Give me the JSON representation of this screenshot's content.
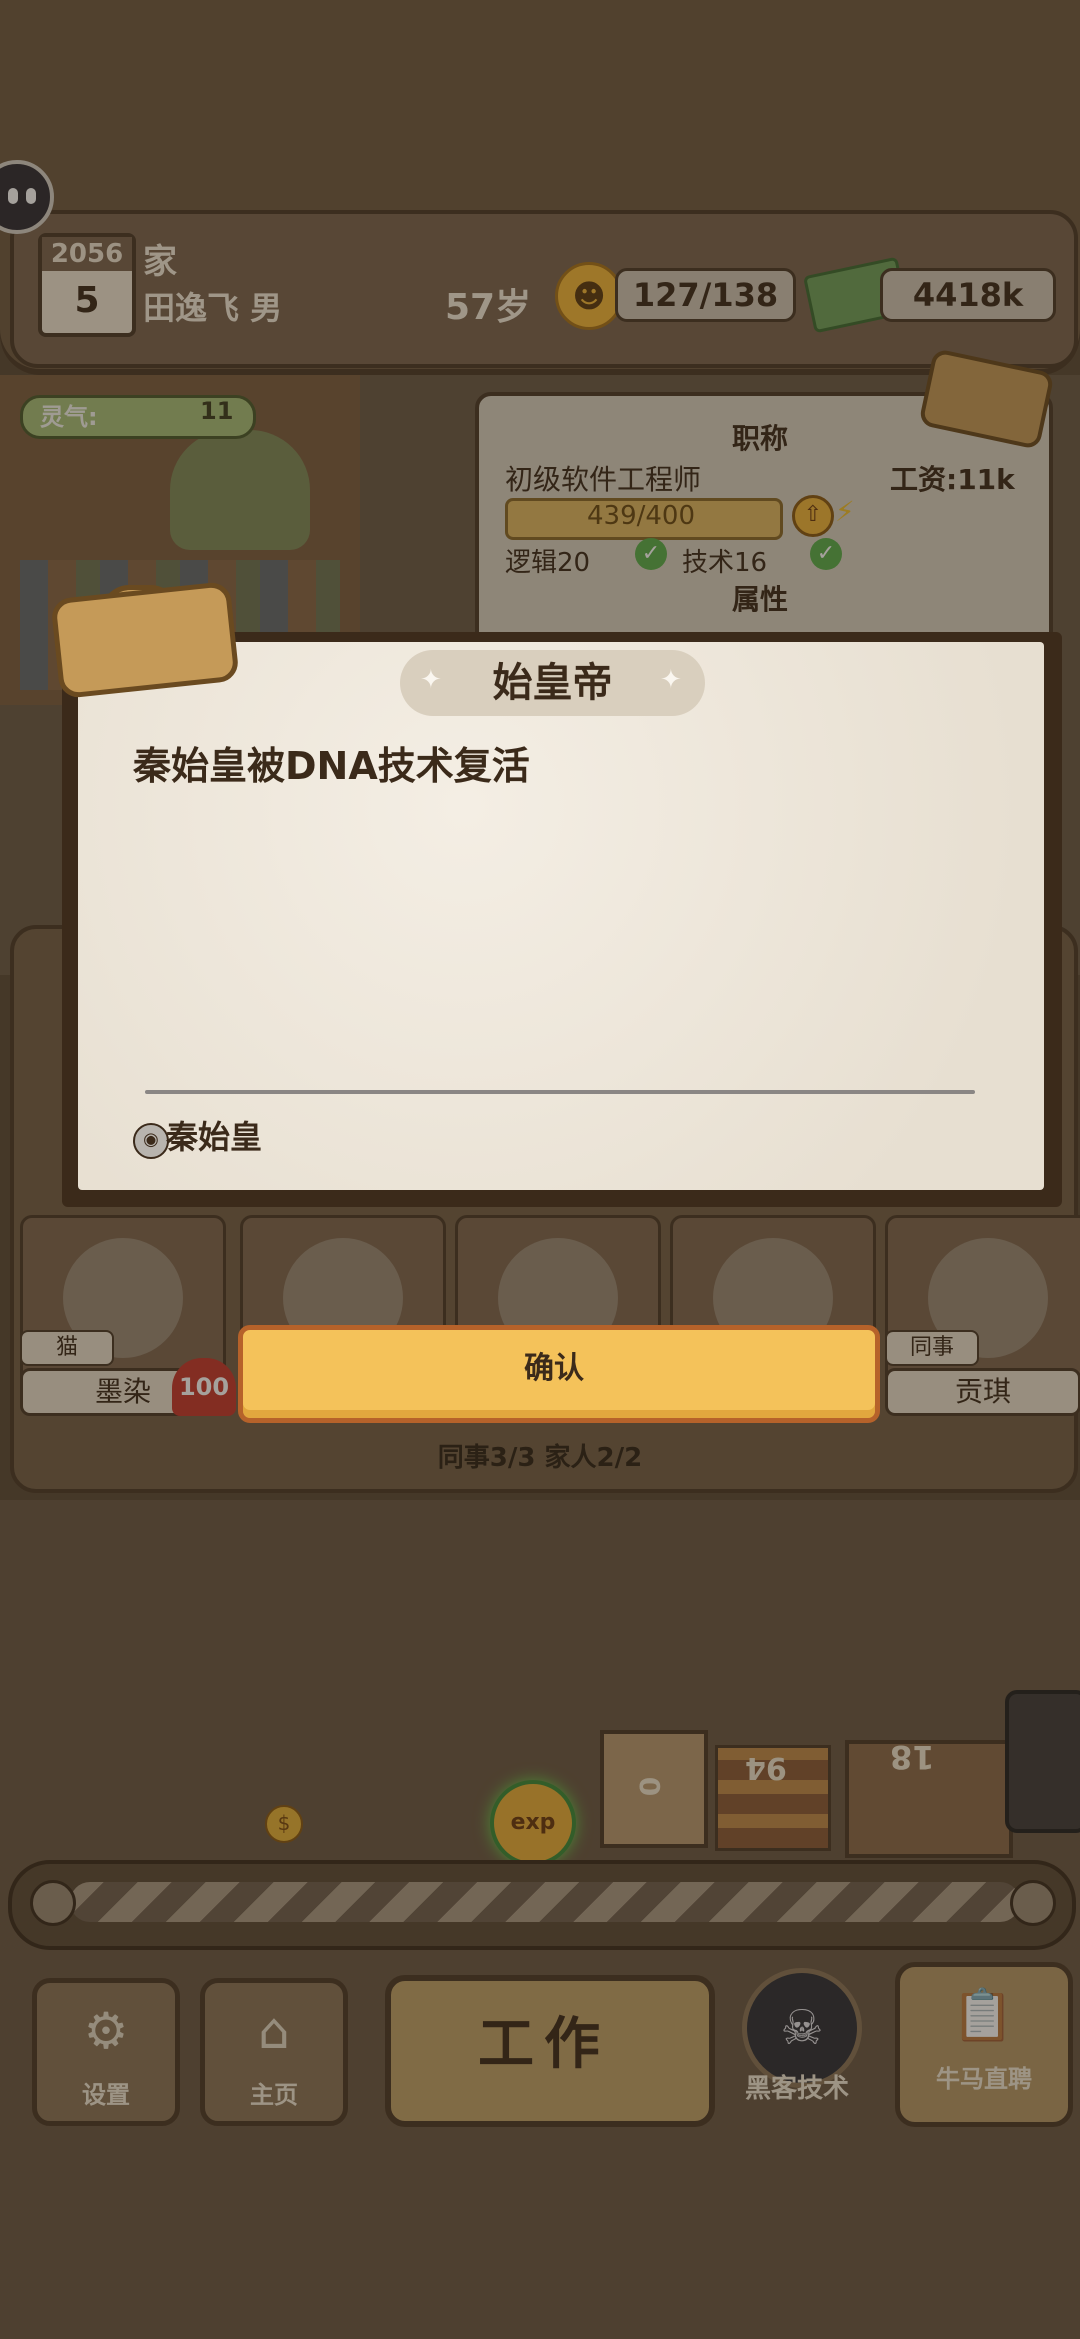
{
  "header": {
    "year": "2056",
    "month": "5",
    "location": "家",
    "player_name": "田逸飞 男",
    "age": "57岁",
    "mood": "127/138",
    "money": "4418k"
  },
  "status": {
    "qi_label": "灵气:",
    "qi_value": "11"
  },
  "job_card": {
    "heading": "职称",
    "title": "初级软件工程师",
    "salary": "工资:11k",
    "exp": "439/400",
    "exp_fraction": 1.0,
    "req_logic": "逻辑20",
    "req_tech": "技术16",
    "attr_heading": "属性"
  },
  "characters": {
    "cat_tag": "猫",
    "cat_name": "墨染",
    "cat_affection": "100",
    "colleague_tag": "同事",
    "colleague_name": "贡琪",
    "counts": "同事3/3 家人2/2"
  },
  "work_area": {
    "bag_count": "0",
    "books_count": "94",
    "desk_count": "18",
    "exp_orb_label": "exp"
  },
  "nav": {
    "settings": "设置",
    "home": "主页",
    "work": "工作",
    "hacker": "黑客技术",
    "recruit": "牛马直聘"
  },
  "modal": {
    "title": "始皇帝",
    "text": "秦始皇被DNA技术复活",
    "unlock_label": "秦始皇",
    "confirm": "确认"
  },
  "icons": {
    "mood": "smiley-face-icon",
    "money": "cash-stack-icon",
    "lock": "lock-icon",
    "upgrade": "arrow-up-icon",
    "bolt": "lightning-icon",
    "check": "check-icon",
    "settings": "gear-icon",
    "home": "house-icon",
    "hacker": "skull-icon",
    "recruit": "clipboard-icon"
  },
  "colors": {
    "confirm_button": "#f4c25a",
    "modal_paper": "#efe8dc",
    "check_green": "#5aae4c"
  }
}
